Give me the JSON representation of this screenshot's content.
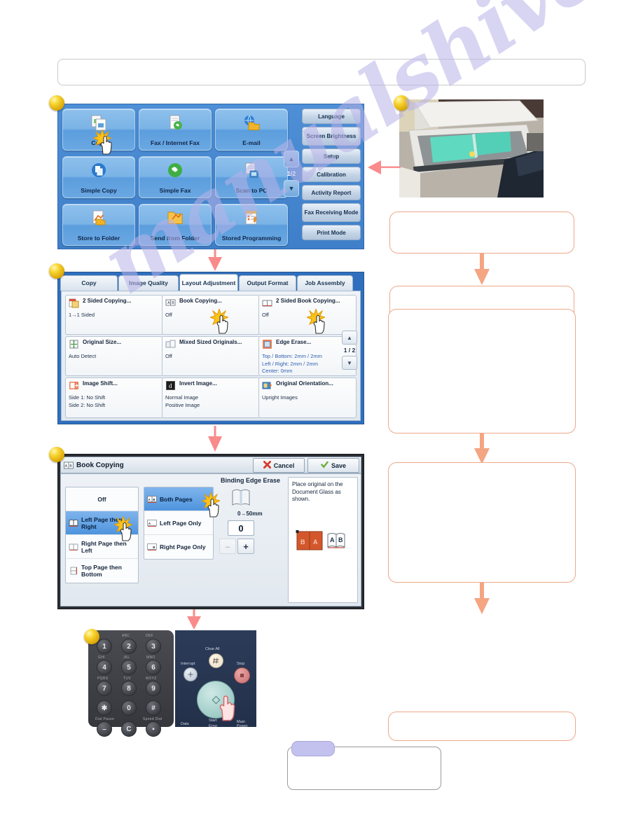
{
  "document": {
    "watermark": "manualshive.com",
    "header_note": ""
  },
  "colors": {
    "panel_blue": "#3f7fc9",
    "tile_blue": "#7ab3e6",
    "selected_blue": "#4f94dd",
    "callout_border": "#eda98a",
    "arrow_salmon": "#f98b8b",
    "arrow_orange": "#f4a582",
    "edge_erase_text": "#2f5fb0",
    "badge_gold": "#f6d02a",
    "watermark_purple": "#b9b3e8"
  },
  "step1_home_screen": {
    "badge": "step-badge",
    "tiles": [
      {
        "label": "Copy",
        "icon": "copy-documents-icon"
      },
      {
        "label": "Fax / Internet Fax",
        "icon": "fax-page-icon"
      },
      {
        "label": "E-mail",
        "icon": "email-globe-folder-icon"
      },
      {
        "label": "Simple Copy",
        "icon": "simple-copy-icon"
      },
      {
        "label": "Simple Fax",
        "icon": "simple-fax-phone-icon"
      },
      {
        "label": "Scan to PC",
        "icon": "scan-to-pc-icon"
      },
      {
        "label": "Store to Folder",
        "icon": "store-to-folder-icon"
      },
      {
        "label": "Send from Folder",
        "icon": "send-from-folder-icon"
      },
      {
        "label": "Stored Programming",
        "icon": "stored-programming-icon"
      }
    ],
    "side_buttons": [
      "Language",
      "Screen Brightness",
      "Setup",
      "Calibration",
      "Activity Report",
      "Fax Receiving Mode",
      "Print Mode"
    ],
    "pager": {
      "up": "▲",
      "down": "▼",
      "page": "1/2"
    },
    "tapped_tile": "Copy"
  },
  "step2_layout_adjustment": {
    "tabs": [
      {
        "label": "Copy",
        "active": false
      },
      {
        "label": "Image Quality",
        "active": false
      },
      {
        "label": "Layout Adjustment",
        "active": true
      },
      {
        "label": "Output Format",
        "active": false
      },
      {
        "label": "Job Assembly",
        "active": false
      }
    ],
    "features": [
      {
        "title": "2 Sided Copying...",
        "values": [
          "1→1 Sided"
        ],
        "icon": "two-sided-copying-icon",
        "blue": false
      },
      {
        "title": "Book Copying...",
        "values": [
          "Off"
        ],
        "icon": "book-copying-icon",
        "blue": false
      },
      {
        "title": "2 Sided Book Copying...",
        "values": [
          "Off"
        ],
        "icon": "two-sided-book-copying-icon",
        "blue": false
      },
      {
        "title": "Original Size...",
        "values": [
          "Auto Detect"
        ],
        "icon": "original-size-icon",
        "blue": false
      },
      {
        "title": "Mixed Sized Originals...",
        "values": [
          "Off"
        ],
        "icon": "mixed-sized-originals-icon",
        "blue": false
      },
      {
        "title": "Edge Erase...",
        "values": [
          "Top / Bottom: 2mm / 2mm",
          "Left / Right: 2mm / 2mm",
          "Center: 0mm"
        ],
        "icon": "edge-erase-icon",
        "blue": true
      },
      {
        "title": "Image Shift...",
        "values": [
          "Side 1: No Shift",
          "Side 2: No Shift"
        ],
        "icon": "image-shift-icon",
        "blue": false
      },
      {
        "title": "Invert Image...",
        "values": [
          "Normal Image",
          "Positive Image"
        ],
        "icon": "invert-image-icon",
        "blue": false
      },
      {
        "title": "Original Orientation...",
        "values": [
          "Upright Images"
        ],
        "icon": "original-orientation-icon",
        "blue": false
      }
    ],
    "pager": {
      "up": "▲",
      "down": "▼",
      "page": "1 / 2"
    },
    "tapped_features": [
      "Book Copying...",
      "2 Sided Book Copying..."
    ]
  },
  "step3_book_copying_dialog": {
    "title": "Book Copying",
    "title_icon": "book-ab-icon",
    "cancel_label": "Cancel",
    "cancel_icon": "cancel-x-icon",
    "save_label": "Save",
    "save_icon": "save-check-icon",
    "order_options": [
      {
        "label": "Off",
        "selected": false,
        "icon": ""
      },
      {
        "label": "Left Page then Right",
        "selected": true,
        "icon": "book-left-right-icon"
      },
      {
        "label": "Right Page then Left",
        "selected": false,
        "icon": "book-right-left-icon"
      },
      {
        "label": "Top Page then Bottom",
        "selected": false,
        "icon": "book-top-bottom-icon"
      }
    ],
    "page_options": [
      {
        "label": "Both Pages",
        "selected": true,
        "icon": "pages-ab-icon"
      },
      {
        "label": "Left Page Only",
        "selected": false,
        "icon": "page-a-icon"
      },
      {
        "label": "Right Page Only",
        "selected": false,
        "icon": "page-b-icon"
      }
    ],
    "binding_edge_erase": {
      "label": "Binding Edge Erase",
      "icon": "binding-edge-book-icon",
      "range": "0→50mm",
      "value": "0",
      "minus": "–",
      "plus": "+"
    },
    "info_text": "Place original on the Document Glass as shown.",
    "info_icon": "book-on-glass-icon",
    "tapped_options": [
      "Left Page then Right",
      "Both Pages"
    ]
  },
  "step4_control_panel": {
    "keys": [
      {
        "cap": "",
        "digit": "1"
      },
      {
        "cap": "ABC",
        "digit": "2"
      },
      {
        "cap": "DEF",
        "digit": "3"
      },
      {
        "cap": "GHI",
        "digit": "4"
      },
      {
        "cap": "JKL",
        "digit": "5"
      },
      {
        "cap": "MNO",
        "digit": "6"
      },
      {
        "cap": "PQRS",
        "digit": "7"
      },
      {
        "cap": "TUV",
        "digit": "8"
      },
      {
        "cap": "WXYZ",
        "digit": "9"
      },
      {
        "cap": "",
        "digit": "✱"
      },
      {
        "cap": "",
        "digit": "0"
      },
      {
        "cap": "",
        "digit": "#"
      },
      {
        "cap": "Dial Pause",
        "digit": "–"
      },
      {
        "cap": "",
        "digit": "C"
      },
      {
        "cap": "Speed Dial",
        "digit": "▪"
      }
    ],
    "right_labels": {
      "clear_all": "Clear All",
      "interrupt": "Interrupt",
      "stop": "Stop",
      "start": "Start",
      "data": "Data",
      "error": "Error",
      "main_power": "Main Power"
    },
    "tapped": "Start"
  },
  "right_column": {
    "photo_caption": "",
    "photo_alt": "document-glass-photo",
    "callouts": [
      {
        "text": ""
      },
      {
        "text": ""
      },
      {
        "text": ""
      },
      {
        "text": ""
      },
      {
        "text": ""
      }
    ]
  },
  "bottom_note": {
    "tab_text": "",
    "body_text": ""
  }
}
